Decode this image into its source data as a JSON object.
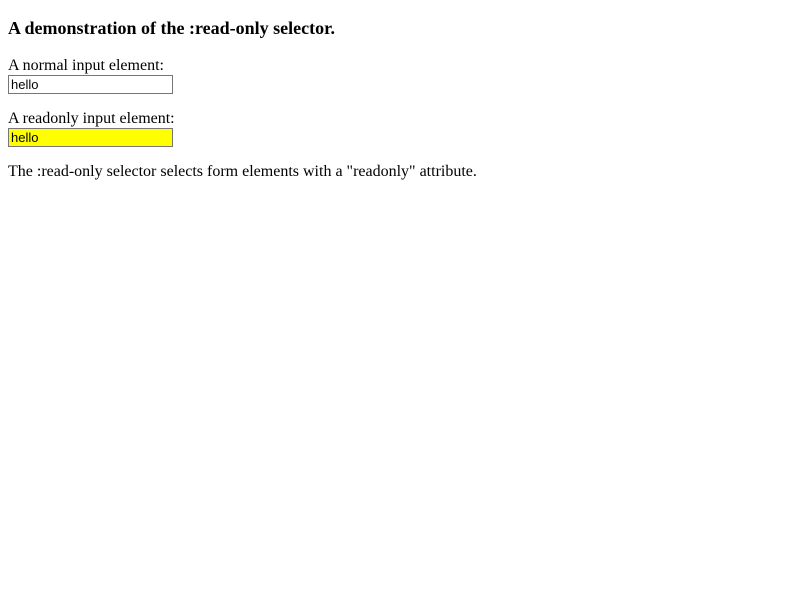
{
  "heading": "A demonstration of the :read-only selector.",
  "normal_label": "A normal input element:",
  "normal_input_value": "hello",
  "readonly_label": "A readonly input element:",
  "readonly_input_value": "hello",
  "explanation": "The :read-only selector selects form elements with a \"readonly\" attribute."
}
